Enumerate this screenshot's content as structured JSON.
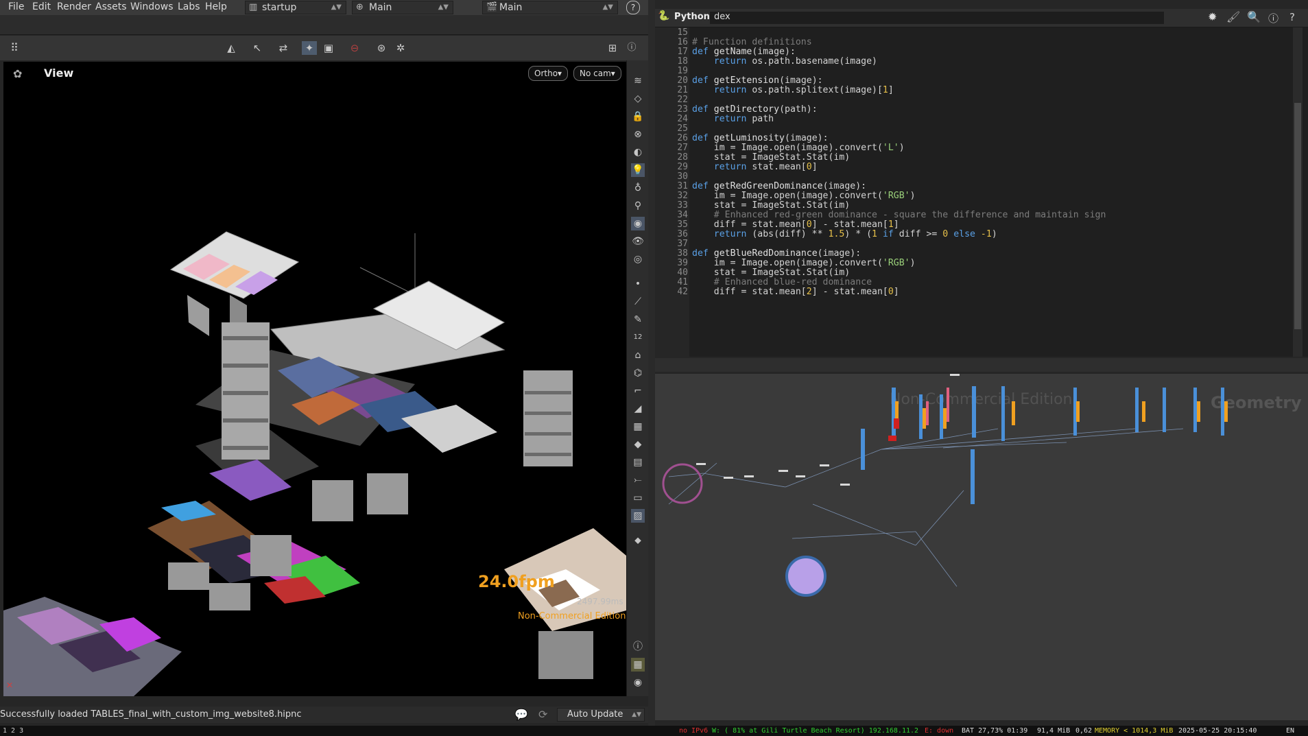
{
  "menu": {
    "items": [
      "File",
      "Edit",
      "Render",
      "Assets",
      "Windows",
      "Labs",
      "Help"
    ],
    "desktop": "startup",
    "context1": "Main",
    "context2": "Main"
  },
  "viewer": {
    "title": "View",
    "projection": "Ortho▾",
    "camera": "No cam▾",
    "fps": "24.0fpm",
    "frame_time": "2497.99ms",
    "edition": "Non-Commercial Edition"
  },
  "status": {
    "message": "Successfully loaded TABLES_final_with_custom_img_website8.hipnc",
    "update_mode": "Auto Update"
  },
  "editor": {
    "language": "Python",
    "filename": "dex",
    "line_numbers": [
      "15",
      "16",
      "17",
      "18",
      "19",
      "20",
      "21",
      "22",
      "23",
      "24",
      "25",
      "26",
      "27",
      "28",
      "29",
      "30",
      "31",
      "32",
      "33",
      "34",
      "35",
      "36",
      "37",
      "38",
      "39",
      "40",
      "41",
      "42"
    ]
  },
  "network": {
    "watermark": "Non-Commercial Edition",
    "context_label": "Geometry"
  },
  "bottom_status": {
    "left": "1 2 3",
    "ipv6": "no IPv6",
    "wifi": "W: ( 81% at Gili Turtle Beach Resort) 192.168.11.2",
    "eth": "E: down",
    "battery": "BAT 27,73% 01:39",
    "mem": "91,4 MiB",
    "load": "0,62",
    "memory": "MEMORY < 1014,3 MiB",
    "datetime": "2025-05-25 20:15:40",
    "lang": "EN"
  },
  "colors": {
    "accent_orange": "#f0a020",
    "node_blue": "#4a90d9",
    "node_purple": "#9a6fd0"
  }
}
